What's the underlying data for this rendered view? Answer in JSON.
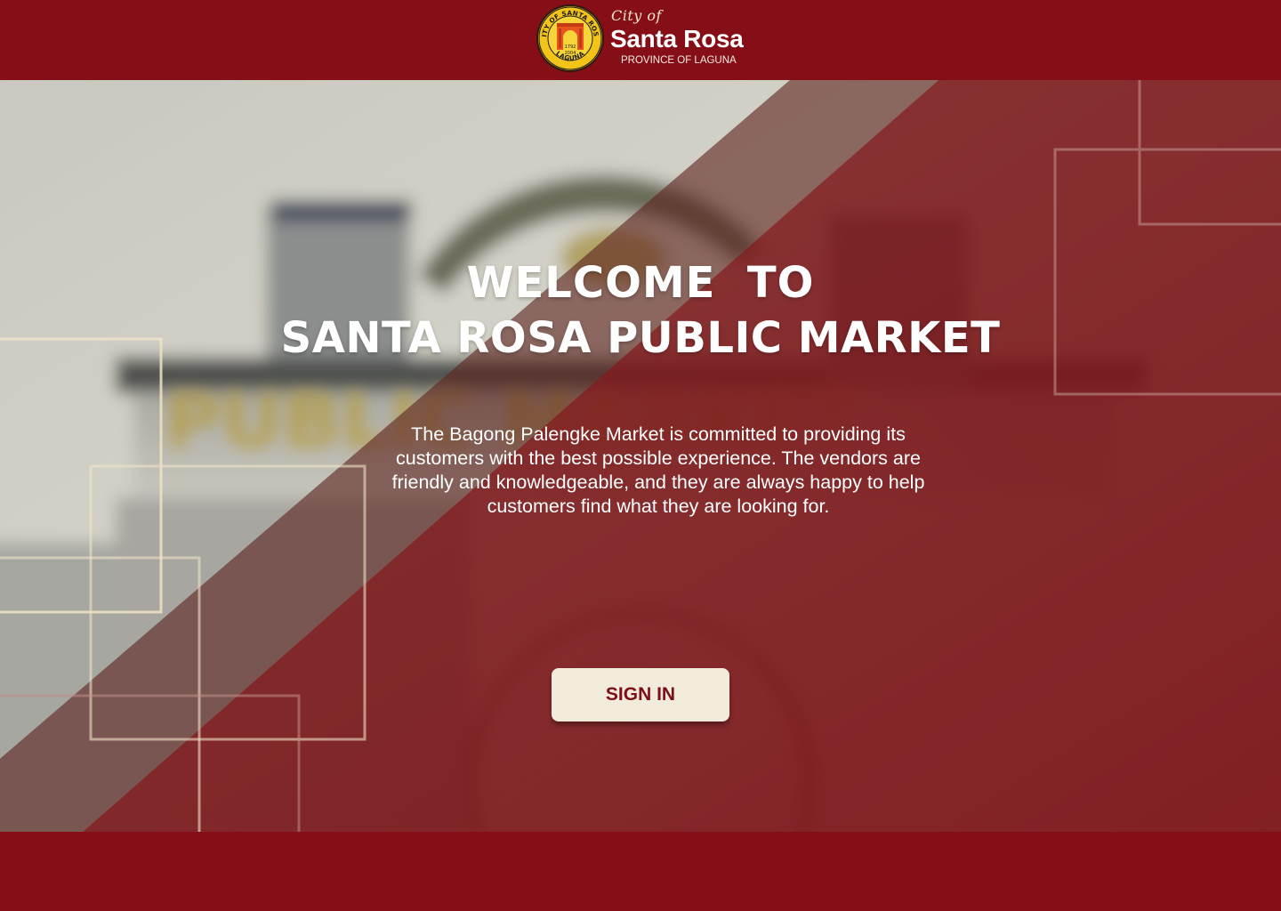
{
  "header": {
    "city_prefix": "City of",
    "city_name": "Santa Rosa",
    "province": "PROVINCE OF LAGUNA",
    "seal": {
      "ring_text": "CITY OF SANTA ROSA",
      "bottom_text": "LAGUNA",
      "year_top": "1792",
      "year_bottom": "2004"
    }
  },
  "hero": {
    "background_sign_text": "PUBLIC MARKET",
    "title_line1": "WELCOME  TO",
    "title_line2": "SANTA ROSA PUBLIC MARKET",
    "description": "The Bagong Palengke Market is committed to providing its customers with the best possible experience. The vendors are friendly and knowledgeable, and they are always happy to help customers find what they are looking for.",
    "signin_label": "SIGN IN"
  },
  "colors": {
    "brand_red": "#860e17",
    "overlay_red": "#82191e",
    "cream": "#f2eadb",
    "frame_cream": "#efe3c6"
  },
  "icons": {
    "seal": "city-seal-icon"
  }
}
